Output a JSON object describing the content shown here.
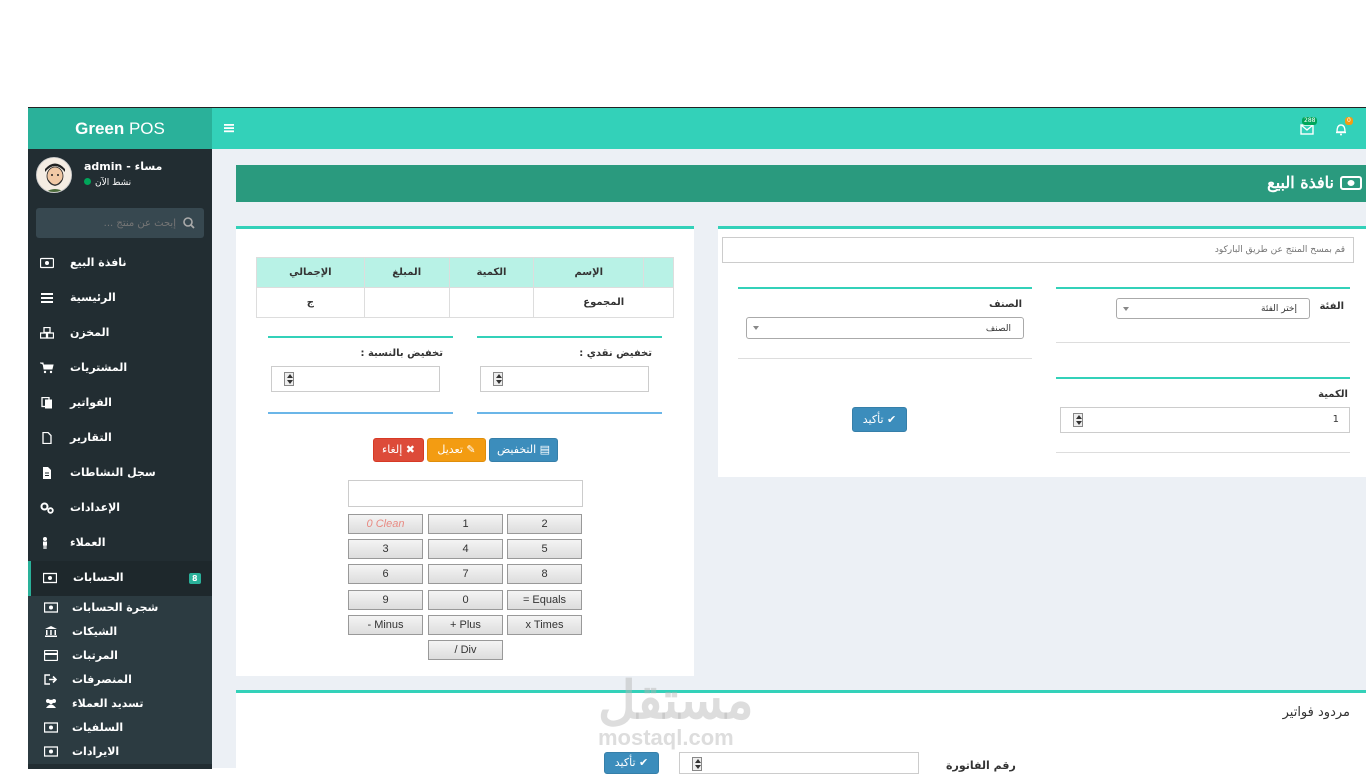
{
  "app": {
    "brand_bold": "Green",
    "brand_rest": " POS"
  },
  "user": {
    "name": "admin - مساء",
    "status": "نشط الآن"
  },
  "search": {
    "placeholder": "إبحث عن منتج ..."
  },
  "sidebar": {
    "items": [
      {
        "label": "نافذة البيع",
        "icon": "cash-icon"
      },
      {
        "label": "الرئيسية",
        "icon": "list-icon"
      },
      {
        "label": "المخزن",
        "icon": "cubes-icon"
      },
      {
        "label": "المشتريات",
        "icon": "cart-icon"
      },
      {
        "label": "الفواتير",
        "icon": "files-icon"
      },
      {
        "label": "التقارير",
        "icon": "file-icon"
      },
      {
        "label": "سجل النشاطات",
        "icon": "file-text-icon"
      },
      {
        "label": "الإعدادات",
        "icon": "cogs-icon"
      },
      {
        "label": "العملاء",
        "icon": "user-icon"
      },
      {
        "label": "الحسابات",
        "icon": "money-icon",
        "badge": "8"
      }
    ],
    "subitems": [
      {
        "label": "شجرة الحسابات",
        "icon": "money-icon"
      },
      {
        "label": "الشيكات",
        "icon": "bank-icon"
      },
      {
        "label": "المرتبات",
        "icon": "credit-card-icon"
      },
      {
        "label": "المنصرفات",
        "icon": "sign-out-icon"
      },
      {
        "label": "تسديد العملاء",
        "icon": "users-icon"
      },
      {
        "label": "السلفيات",
        "icon": "money-icon"
      },
      {
        "label": "الايرادات",
        "icon": "money-icon"
      }
    ]
  },
  "topbar": {
    "mail_count": "288",
    "notif_count": "0"
  },
  "page": {
    "title": "نافذة البيع"
  },
  "cart": {
    "headers": [
      "",
      "الإسم",
      "الكمية",
      "المبلغ",
      "الإجمالي"
    ],
    "total_label": "المجموع",
    "total_value": "ج"
  },
  "discount": {
    "cash_label": "تخفيض نقدي :",
    "percent_label": "تخفيض بالنسبة :"
  },
  "actions": {
    "discount": "التخفيض",
    "edit": "تعديل",
    "cancel": "إلغاء"
  },
  "calculator": {
    "buttons": [
      [
        "2",
        "1",
        "0 Clean"
      ],
      [
        "5",
        "4",
        "3"
      ],
      [
        "8",
        "7",
        "6"
      ],
      [
        "= Equals",
        "0",
        "9"
      ],
      [
        "x Times",
        "+ Plus",
        "- Minus"
      ],
      [
        "",
        "/ Div",
        ""
      ]
    ]
  },
  "product_form": {
    "barcode_placeholder": "قم بمسح المنتج عن طريق الباركود",
    "category_label": "الفئة",
    "category_value": "إختر الفئة",
    "item_label": "الصنف",
    "item_value": "الصنف",
    "quantity_label": "الكمية",
    "quantity_value": "1",
    "confirm": "تأكيد"
  },
  "returns": {
    "title": "مردود فواتير",
    "invoice_label": "رقم الفاتورة",
    "confirm": "تأكيد"
  },
  "watermark": {
    "text": "مستقل",
    "sub": "mostaql.com"
  }
}
